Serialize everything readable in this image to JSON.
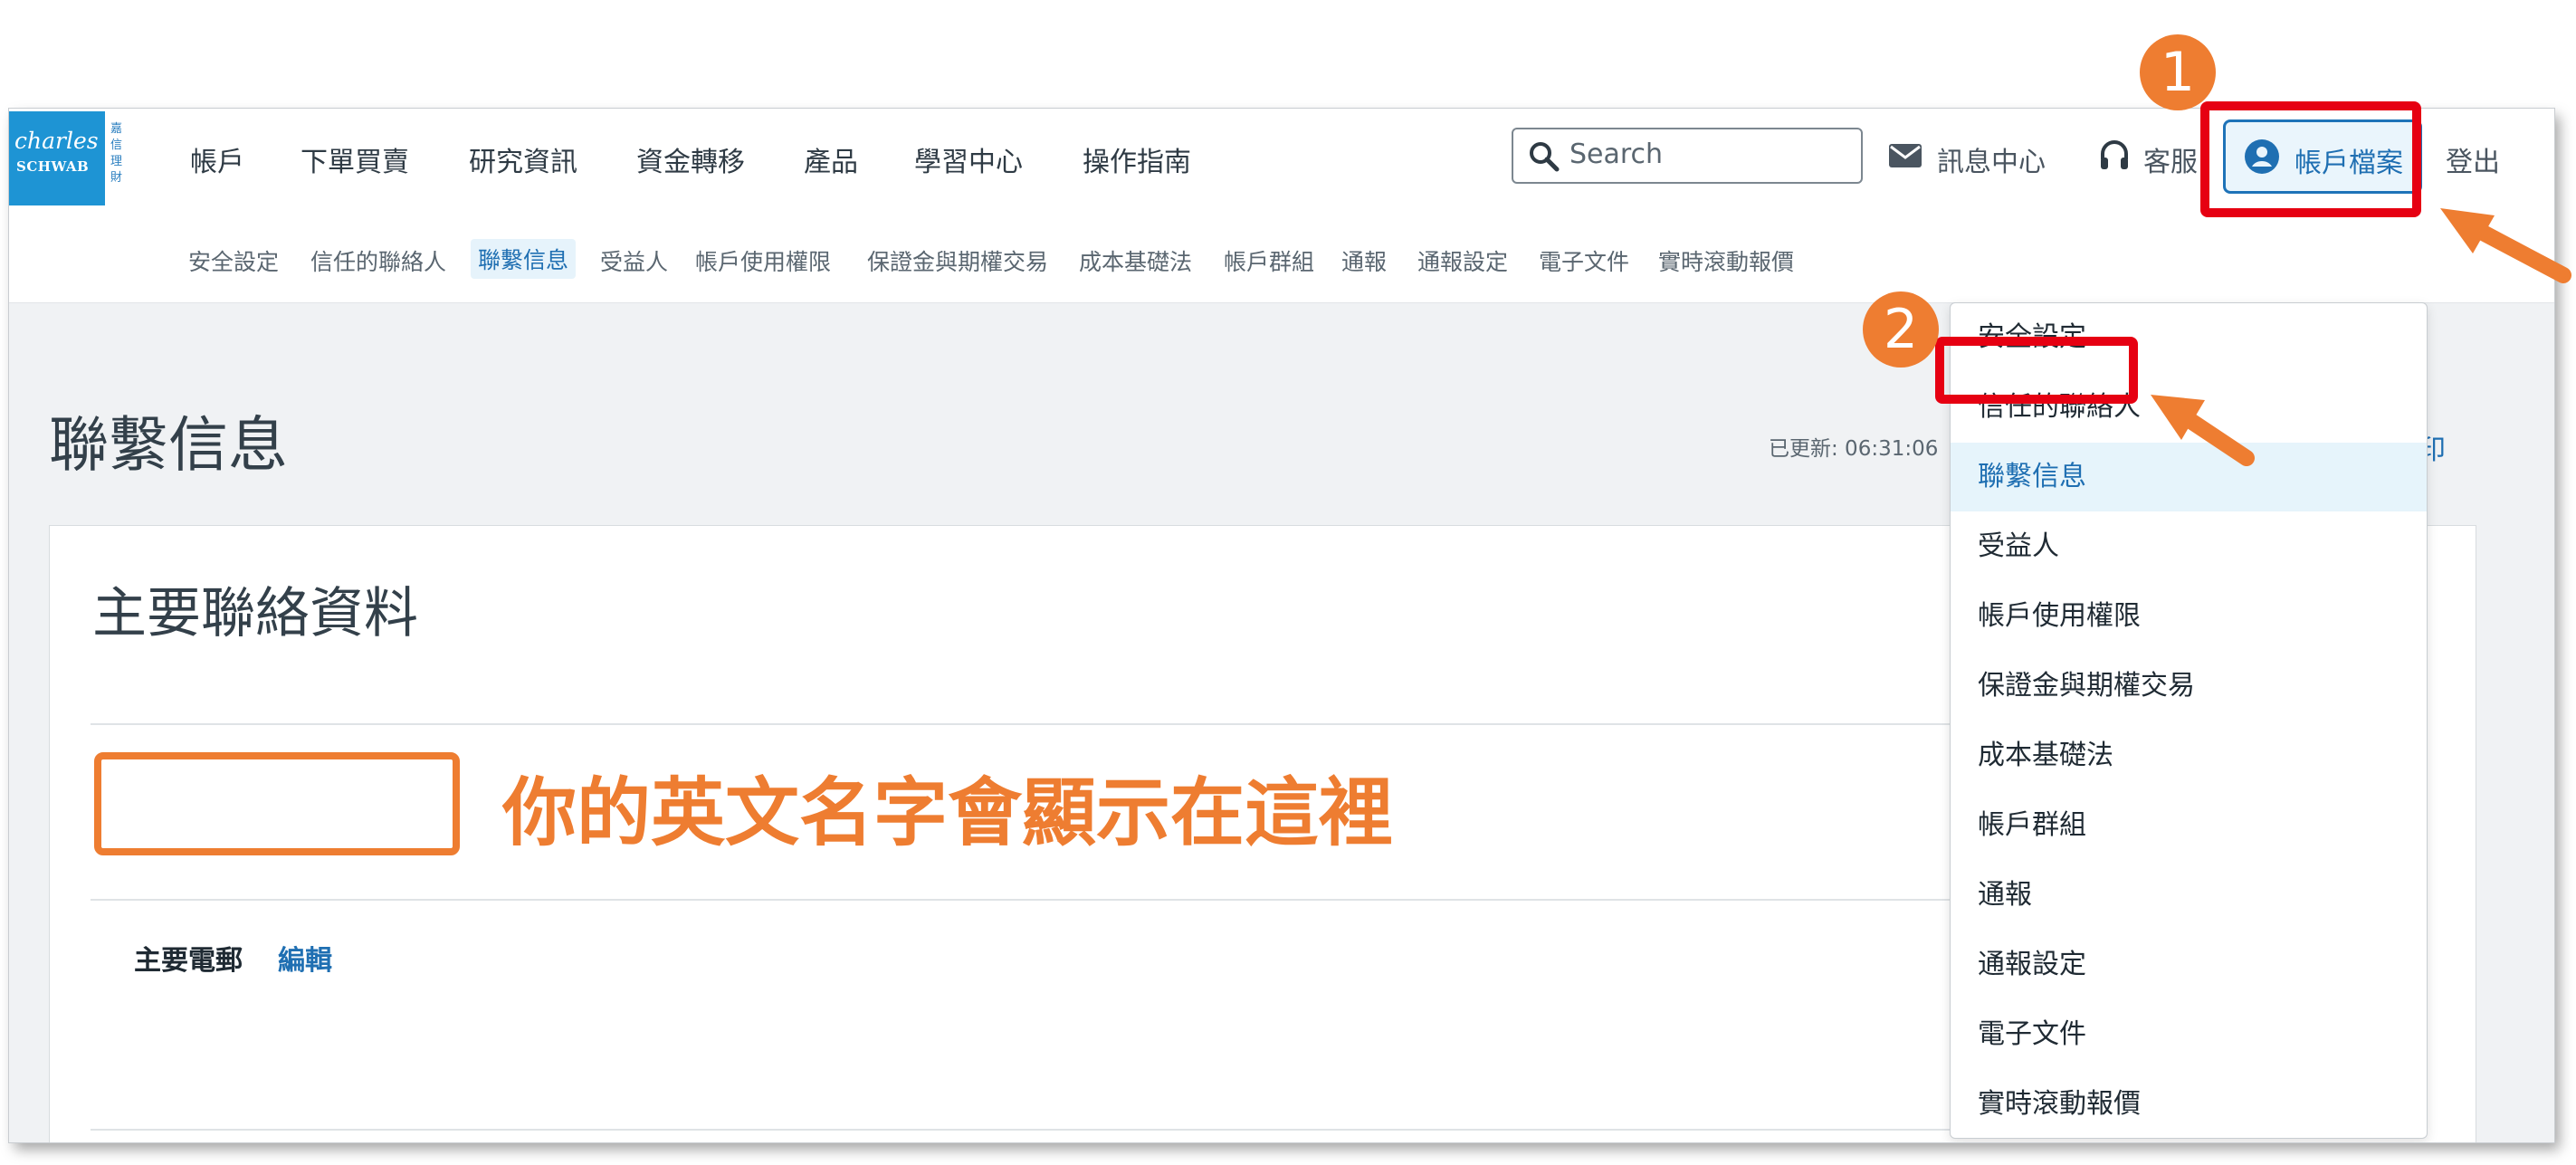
{
  "logo": {
    "line1": "charles",
    "line2": "SCHWAB",
    "cn": "嘉信理財"
  },
  "nav": [
    "帳戶",
    "下單買賣",
    "研究資訊",
    "資金轉移",
    "產品",
    "學習中心",
    "操作指南"
  ],
  "search": {
    "placeholder": "Search"
  },
  "utility": {
    "messages": "訊息中心",
    "support": "客服",
    "profile": "帳戶檔案",
    "logout": "登出"
  },
  "subnav": [
    "安全設定",
    "信任的聯絡人",
    "聯繫信息",
    "受益人",
    "帳戶使用權限",
    "保證金與期權交易",
    "成本基礎法",
    "帳戶群組",
    "通報",
    "通報設定",
    "電子文件",
    "實時滾動報價"
  ],
  "page": {
    "title": "聯繫信息",
    "updated": "已更新: 06:31:06",
    "print": "印"
  },
  "card": {
    "title": "主要聯絡資料",
    "phone_label": "主要電郵",
    "edit": "編輯"
  },
  "dropdown": {
    "items": [
      "安全設定",
      "信任的聯絡人",
      "聯繫信息",
      "受益人",
      "帳戶使用權限",
      "保證金與期權交易",
      "成本基礎法",
      "帳戶群組",
      "通報",
      "通報設定",
      "電子文件",
      "實時滾動報價"
    ],
    "selected": "聯繫信息"
  },
  "annotations": {
    "step1": "1",
    "step2": "2",
    "name_hint": "你的英文名字會顯示在這裡"
  },
  "colors": {
    "brand": "#1e94d4",
    "link": "#1f6fb2",
    "annotation_orange": "#ee7d31",
    "annotation_red": "#e60012"
  }
}
